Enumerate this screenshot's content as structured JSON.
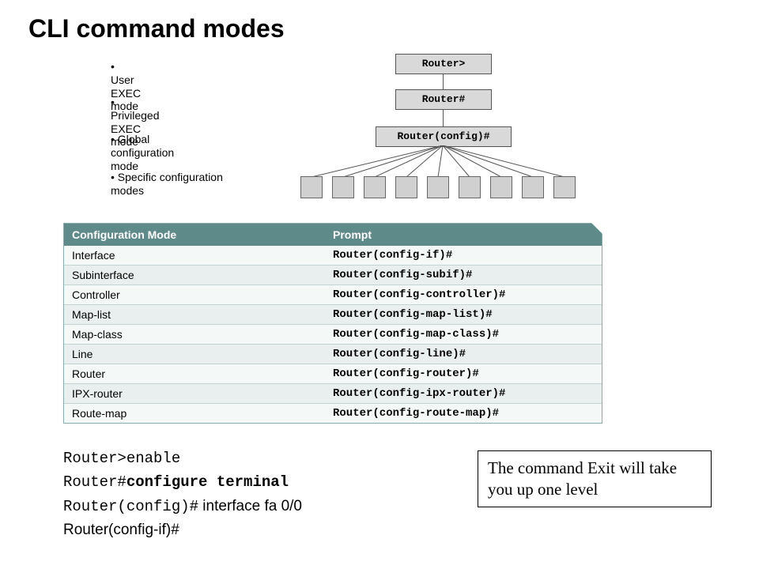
{
  "title": "CLI command modes",
  "bullets": {
    "b1": "User EXEC mode",
    "b2": "Privileged EXEC mode",
    "b3": "Global configuration mode",
    "b4": "Specific configuration modes"
  },
  "hier": {
    "h1": "Router>",
    "h2": "Router#",
    "h3": "Router(config)#"
  },
  "table": {
    "head_mode": "Configuration Mode",
    "head_prompt": "Prompt",
    "rows": [
      {
        "mode": "Interface",
        "prompt": "Router(config-if)#"
      },
      {
        "mode": "Subinterface",
        "prompt": "Router(config-subif)#"
      },
      {
        "mode": "Controller",
        "prompt": "Router(config-controller)#"
      },
      {
        "mode": "Map-list",
        "prompt": "Router(config-map-list)#"
      },
      {
        "mode": "Map-class",
        "prompt": "Router(config-map-class)#"
      },
      {
        "mode": "Line",
        "prompt": "Router(config-line)#"
      },
      {
        "mode": "Router",
        "prompt": "Router(config-router)#"
      },
      {
        "mode": "IPX-router",
        "prompt": "Router(config-ipx-router)#"
      },
      {
        "mode": "Route-map",
        "prompt": "Router(config-route-map)#"
      }
    ]
  },
  "commands": {
    "l1_prefix": "Router>",
    "l1_cmd": "enable",
    "l2_prefix": "Router#",
    "l2_cmd": "configure terminal",
    "l3_prefix": "Router(config)#",
    "l3_cmd": " interface fa 0/0",
    "l4": "Router(config-if)#"
  },
  "callout": "The command Exit will take you up one level"
}
